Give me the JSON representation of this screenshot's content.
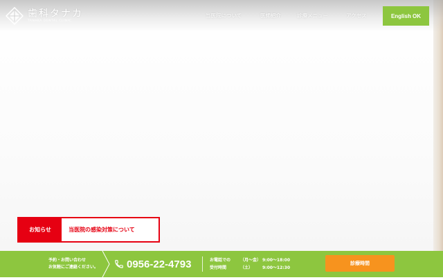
{
  "header": {
    "logo_main": "歯科タナカ",
    "logo_sub": "TANAKA DENTAL CLINIC",
    "nav": [
      {
        "label": "当医院について"
      },
      {
        "label": "医師紹介"
      },
      {
        "label": "診療メニュー"
      },
      {
        "label": "アクセス"
      }
    ],
    "english_label": "English OK"
  },
  "notice": {
    "label": "お知らせ",
    "text": "当医院の感染対策について"
  },
  "footer": {
    "reserve_line1": "予約・お問い合わせ",
    "reserve_line2": "お気軽にご連絡ください。",
    "phone": "0956-22-4793",
    "hours": [
      {
        "key": "お電話での",
        "days": "（月〜金）",
        "time": "9:00〜18:00"
      },
      {
        "key": "受付時間",
        "days": "（土）",
        "time": "9:00〜12:30"
      }
    ],
    "schedule_button": "診療時間"
  },
  "colors": {
    "brand_green": "#8dc63f",
    "accent_red": "#e60012",
    "accent_orange": "#f7931e"
  },
  "icons": [
    "logo-mark-icon",
    "phone-icon",
    "chevron-right-icon"
  ]
}
